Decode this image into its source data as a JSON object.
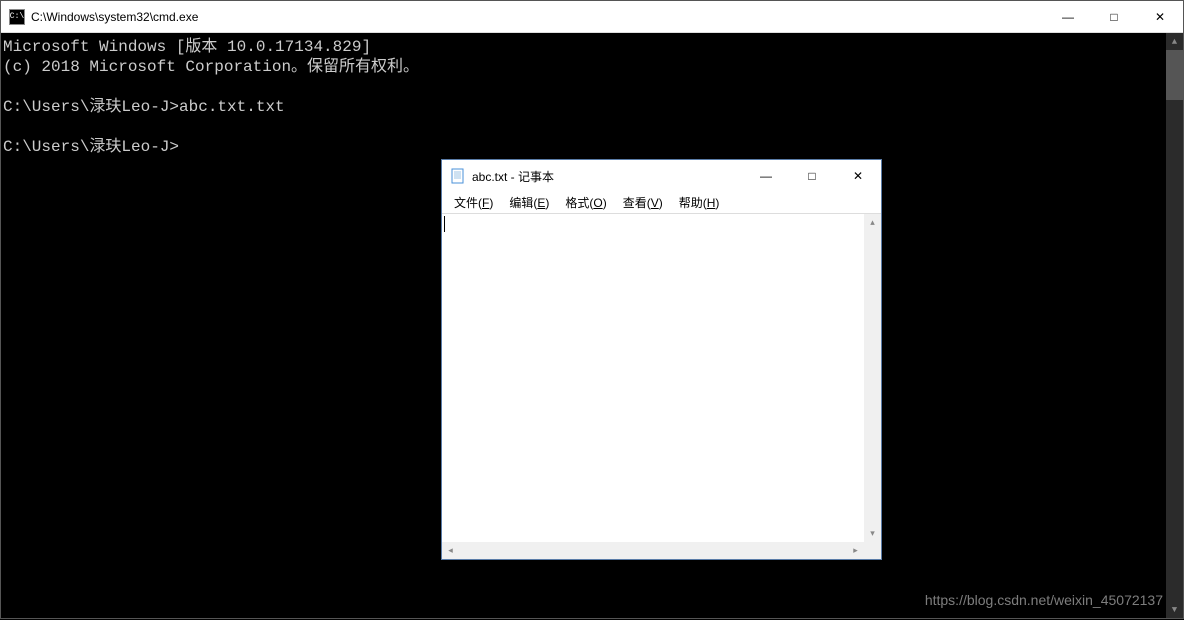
{
  "cmd": {
    "title": "C:\\Windows\\system32\\cmd.exe",
    "icon_text": "C:\\",
    "lines": {
      "l1": "Microsoft Windows [版本 10.0.17134.829]",
      "l2": "(c) 2018 Microsoft Corporation。保留所有权利。",
      "l3": "",
      "l4": "C:\\Users\\渌玞Leo-J>abc.txt.txt",
      "l5": "",
      "l6": "C:\\Users\\渌玞Leo-J>"
    },
    "controls": {
      "minimize": "—",
      "maximize": "□",
      "close": "✕"
    }
  },
  "notepad": {
    "title": "abc.txt - 记事本",
    "menus": {
      "file": "文件(F)",
      "edit": "编辑(E)",
      "format": "格式(O)",
      "view": "查看(V)",
      "help": "帮助(H)"
    },
    "content": "",
    "controls": {
      "minimize": "—",
      "maximize": "□",
      "close": "✕"
    }
  },
  "watermark": "https://blog.csdn.net/weixin_45072137"
}
